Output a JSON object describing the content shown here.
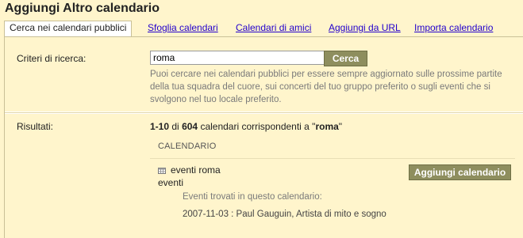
{
  "header": {
    "title": "Aggiungi Altro calendario"
  },
  "tabs": [
    {
      "label": "Cerca nei calendari pubblici",
      "active": true
    },
    {
      "label": "Sfoglia calendari"
    },
    {
      "label": "Calendari di amici"
    },
    {
      "label": "Aggiungi da URL"
    },
    {
      "label": "Importa calendario"
    }
  ],
  "search": {
    "label": "Criteri di ricerca:",
    "value": "roma",
    "button": "Cerca",
    "help": "Puoi cercare nei calendari pubblici per essere sempre aggiornato sulle prossime partite della tua squadra del cuore, sui concerti del tuo gruppo preferito o sugli eventi che si svolgono nel tuo locale preferito."
  },
  "results": {
    "label": "Risultati:",
    "range": "1-10",
    "of": "di",
    "total": "604",
    "text": "calendari corrispondenti a \"",
    "query": "roma",
    "text_end": "\"",
    "column_header": "CALENDARIO",
    "items": [
      {
        "name": "eventi roma",
        "description": "eventi",
        "add_button": "Aggiungi calendario",
        "found_label": "Eventi trovati in questo calendario:",
        "event": "2007-11-03 : Paul Gauguin, Artista di mito e sogno"
      }
    ]
  },
  "colors": {
    "accent_button": "#8e8e5e",
    "link": "#2200cc",
    "panel_bg": "#fff5cc"
  }
}
